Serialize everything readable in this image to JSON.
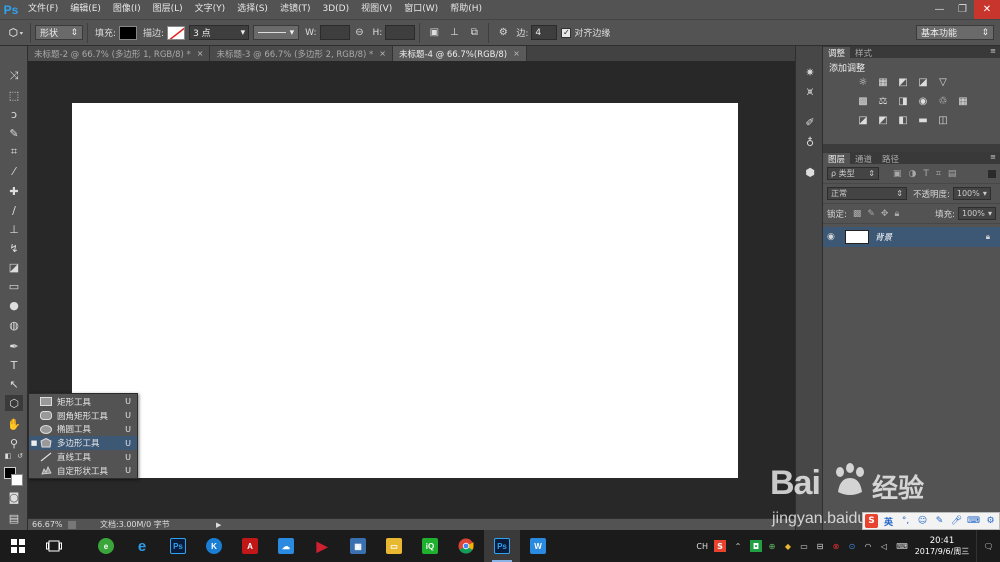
{
  "app": {
    "logo": "Ps"
  },
  "menu": [
    "文件(F)",
    "编辑(E)",
    "图像(I)",
    "图层(L)",
    "文字(Y)",
    "选择(S)",
    "滤镜(T)",
    "3D(D)",
    "视图(V)",
    "窗口(W)",
    "帮助(H)"
  ],
  "window_controls": {
    "minimize": "—",
    "restore": "❐",
    "close": "✕"
  },
  "options": {
    "mode": "形状",
    "fill_label": "填充:",
    "stroke_label": "描边:",
    "stroke_size": "3 点",
    "w_label": "W:",
    "h_label": "H:",
    "sides_label": "边:",
    "sides_value": "4",
    "align_edges_label": "对齐边缘",
    "align_edges_checked": "✓",
    "workspace": "基本功能",
    "fill_color": "#000000"
  },
  "tabs": [
    {
      "label": "未标题-2 @ 66.7% (多边形 1, RGB/8) *",
      "close": "×"
    },
    {
      "label": "未标题-3 @ 66.7% (多边形 2, RGB/8) *",
      "close": "×"
    },
    {
      "label": "未标题-4 @ 66.7%(RGB/8)",
      "close": "×"
    }
  ],
  "flyout": {
    "items": [
      {
        "label": "矩形工具",
        "key": "U",
        "marker": ""
      },
      {
        "label": "圆角矩形工具",
        "key": "U",
        "marker": ""
      },
      {
        "label": "椭圆工具",
        "key": "U",
        "marker": ""
      },
      {
        "label": "多边形工具",
        "key": "U",
        "marker": "■"
      },
      {
        "label": "直线工具",
        "key": "U",
        "marker": ""
      },
      {
        "label": "自定形状工具",
        "key": "U",
        "marker": ""
      }
    ]
  },
  "status": {
    "zoom": "66.67%",
    "doc": "文档:3.00M/0 字节",
    "arrow": "▶"
  },
  "panels": {
    "adjust_tab": "调整",
    "styles_tab": "样式",
    "adjust_title": "添加调整",
    "layers_tab": "图层",
    "channels_tab": "通道",
    "paths_tab": "路径",
    "filter_kind": "ρ 类型",
    "blend_mode": "正常",
    "opacity_label": "不透明度:",
    "opacity_value": "100%",
    "lock_label": "锁定:",
    "fill_label": "填充:",
    "fill_value": "100%",
    "layer_name": "背景"
  },
  "ime": {
    "lang": "英"
  },
  "tray": {
    "ch": "CH",
    "time": "20:41",
    "date": "2017/9/6/周三"
  },
  "watermark": {
    "brand_left": "Bai",
    "brand_right": "经验",
    "url": "jingyan.baidu.com"
  }
}
